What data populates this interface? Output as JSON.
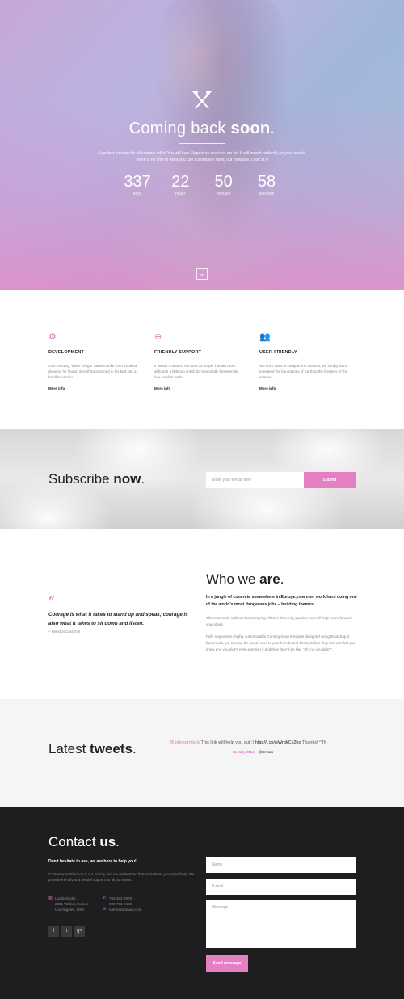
{
  "hero": {
    "title_light": "Coming back",
    "title_bold": "soon",
    "title_end": ".",
    "text": "A perfect solution for all creative folks! You will love Elegant as much as we do. It will morph perfectly on your needs! There is no limit to what you can accomplish using our template. Look at it!",
    "countdown": [
      {
        "value": "337",
        "label": "days"
      },
      {
        "value": "22",
        "label": "hours"
      },
      {
        "value": "50",
        "label": "minutes"
      },
      {
        "value": "58",
        "label": "seconds"
      }
    ],
    "scroll_glyph": "⌄"
  },
  "features": [
    {
      "icon": "gears-icon",
      "glyph": "⚙",
      "title": "DEVELOPMENT",
      "text": "One morning, when Gregor Samsa woke from troubled dreams, he found himself transformed in his bed into a horrible vermin.",
      "more": "More info"
    },
    {
      "icon": "lifebuoy-icon",
      "glyph": "⊕",
      "title": "FRIENDLY SUPPORT",
      "text": "It wasn't a dream. His room, a proper human room although a little too small, lay peacefully between its four familiar walls.",
      "more": "More info"
    },
    {
      "icon": "users-icon",
      "glyph": "👥",
      "title": "USER-FRIENDLY",
      "text": "We don't want to conquer the cosmos, we simply want to extend the boundaries of Earth to the frontiers of the cosmos.",
      "more": "More info"
    }
  ],
  "subscribe": {
    "title_light": "Subscribe",
    "title_bold": "now",
    "title_end": ".",
    "placeholder": "Enter your e-mail here",
    "button": "Submit"
  },
  "who": {
    "quote_mark": "“",
    "quote": "Courage is what it takes to stand up and speak; courage is also what it takes to sit down and listen.",
    "author": "– Winston Churchill",
    "title_light": "Who we",
    "title_bold": "are",
    "title_end": ".",
    "lead": "In a jungle of concrete somewhere in Europe, raw men work hard doing one of the world's most dangerous jobs – building themes.",
    "p1": "This extremely ruthless but satisfying effort is driven by passion and will help move forward your ideas.",
    "p2": "Fully responsive, highly customizable Coming Soon template designed using Bootstrap 3 framework, yo! Spread the good news to your friends and family before they find out that you knew and you didn't even mention it and then they'd be like, \"oh, no you didn't\"."
  },
  "tweets": {
    "title_light": "Latest",
    "title_bold": "tweets",
    "title_end": ".",
    "user": "@johnkerrduck",
    "text": " This link will help you out :) ",
    "link": "http://t.co/wWrgkCk2ho",
    "text_end": " Thanks! ^TK",
    "date": "21 July 2014",
    "via": "@Envato"
  },
  "contact": {
    "title_light": "Contact",
    "title_bold": "us",
    "title_end": ".",
    "lead": "Don't hesitate to ask, we are here to help you!",
    "text": "Customer satisfaction is our priority and we understand that sometimes you need help. We provide friendly and helpful support for all our items.",
    "address": [
      "Lumberjacks",
      "2801 Walnut Avenue",
      "Los Angeles, USA"
    ],
    "phones": [
      "765-302-2878",
      "900-765-9492"
    ],
    "email": "name@domain.com",
    "social": [
      "f",
      "t",
      "g+"
    ],
    "name_placeholder": "Name",
    "email_placeholder": "E-mail",
    "message_placeholder": "Message",
    "button": "Send message"
  }
}
